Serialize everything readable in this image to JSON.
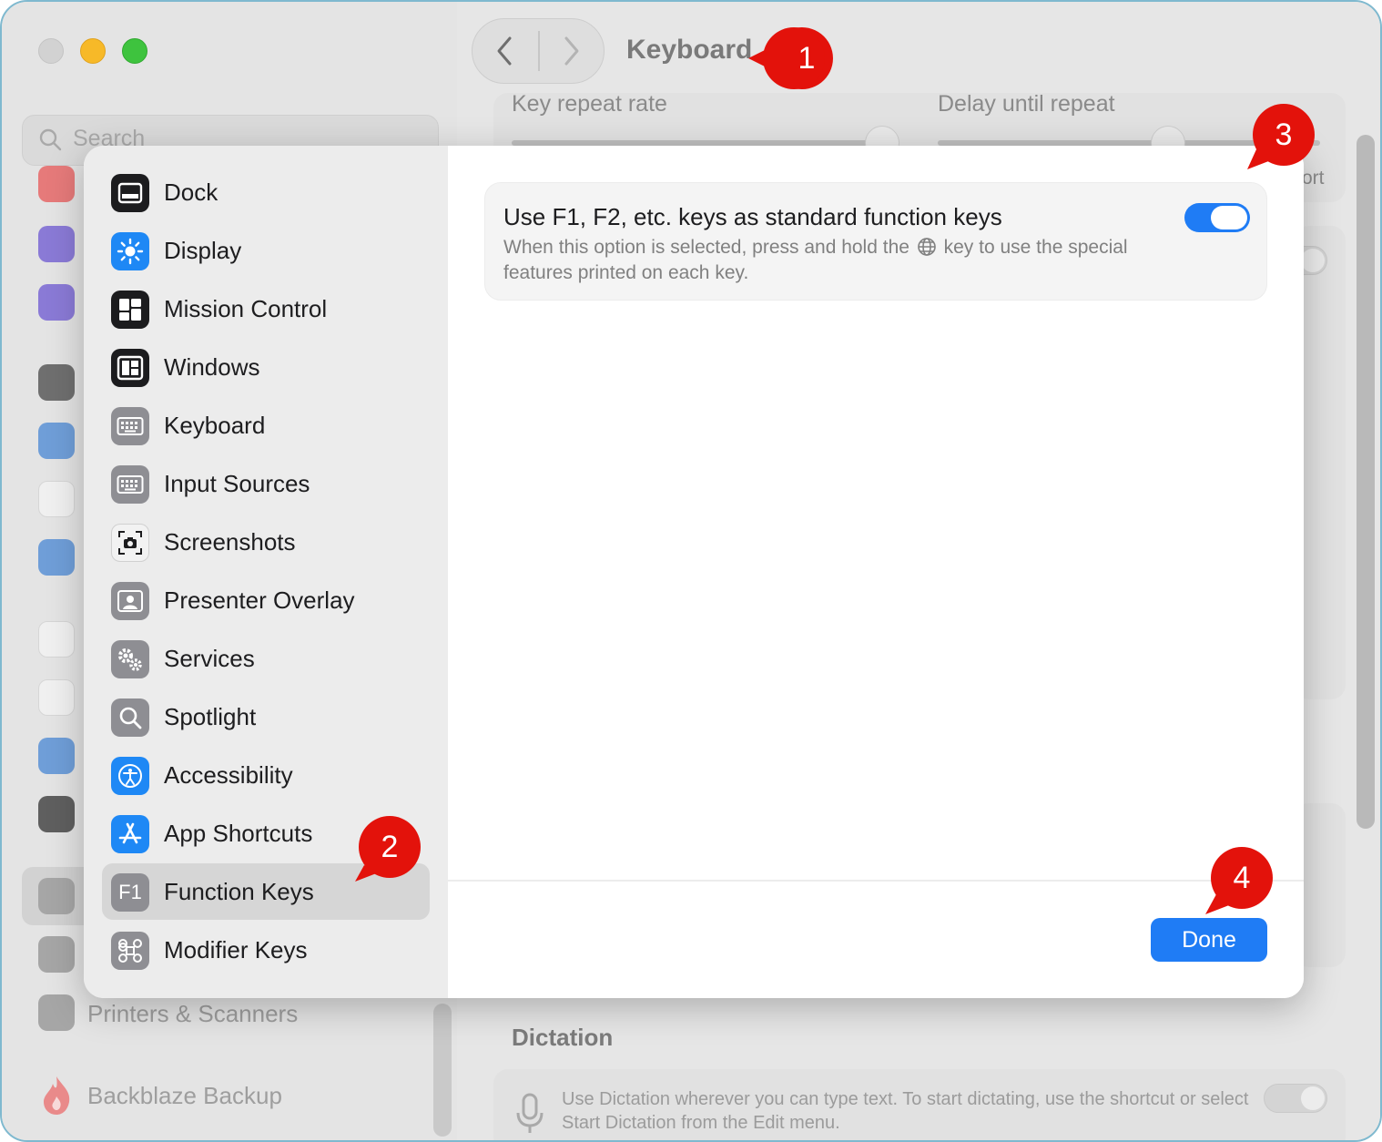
{
  "window": {
    "title": "Keyboard"
  },
  "background": {
    "search_placeholder": "Search",
    "sidebar_items": [
      {
        "label": "Printers & Scanners"
      },
      {
        "label": "Backblaze Backup"
      }
    ],
    "main": {
      "key_repeat_label": "Key repeat rate",
      "delay_label": "Delay until repeat",
      "partial_text": "ort",
      "dictation_heading": "Dictation",
      "dictation_text": "Use Dictation wherever you can type text. To start dictating, use the shortcut or select Start Dictation from the Edit menu."
    }
  },
  "sheet": {
    "sidebar": {
      "items": [
        {
          "label": "Dock",
          "icon": "dock-icon",
          "color": "#1c1c1e"
        },
        {
          "label": "Display",
          "icon": "sun-icon",
          "color": "#1e88f5"
        },
        {
          "label": "Mission Control",
          "icon": "mission-control-icon",
          "color": "#1c1c1e"
        },
        {
          "label": "Windows",
          "icon": "windows-icon",
          "color": "#1c1c1e"
        },
        {
          "label": "Keyboard",
          "icon": "keyboard-icon",
          "color": "#8e8e93"
        },
        {
          "label": "Input Sources",
          "icon": "keyboard-icon",
          "color": "#8e8e93"
        },
        {
          "label": "Screenshots",
          "icon": "camera-icon",
          "color": "#f2f2f2"
        },
        {
          "label": "Presenter Overlay",
          "icon": "person-icon",
          "color": "#8e8e93"
        },
        {
          "label": "Services",
          "icon": "gears-icon",
          "color": "#8e8e93"
        },
        {
          "label": "Spotlight",
          "icon": "magnifier-icon",
          "color": "#8e8e93"
        },
        {
          "label": "Accessibility",
          "icon": "accessibility-icon",
          "color": "#1e88f5"
        },
        {
          "label": "App Shortcuts",
          "icon": "app-store-icon",
          "color": "#1e88f5"
        },
        {
          "label": "Function Keys",
          "icon": "f1-icon",
          "color": "#8e8e93",
          "selected": true
        },
        {
          "label": "Modifier Keys",
          "icon": "command-icon",
          "color": "#8e8e93"
        }
      ],
      "f1_text": "F1"
    },
    "option": {
      "title": "Use F1, F2, etc. keys as standard function keys",
      "desc_before": "When this option is selected, press and hold the",
      "desc_after": "key to use the special features printed on each key.",
      "enabled": true
    },
    "done_label": "Done"
  },
  "callouts": [
    {
      "label": "1"
    },
    {
      "label": "2"
    },
    {
      "label": "3"
    },
    {
      "label": "4"
    }
  ],
  "colors": {
    "accent": "#1f7cf5",
    "callout": "#e3120b"
  }
}
